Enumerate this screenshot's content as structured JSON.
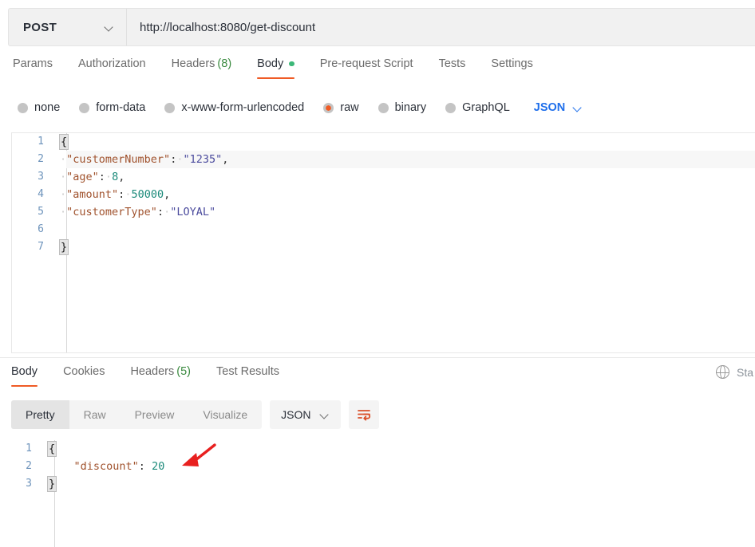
{
  "request": {
    "method": "POST",
    "url": "http://localhost:8080/get-discount",
    "method_caret_icon": "chevron-down-icon",
    "tabs": [
      {
        "label": "Params",
        "active": false,
        "count": "",
        "dot": false
      },
      {
        "label": "Authorization",
        "active": false,
        "count": "",
        "dot": false
      },
      {
        "label": "Headers",
        "active": false,
        "count": "(8)",
        "dot": false
      },
      {
        "label": "Body",
        "active": true,
        "count": "",
        "dot": true
      },
      {
        "label": "Pre-request Script",
        "active": false,
        "count": "",
        "dot": false
      },
      {
        "label": "Tests",
        "active": false,
        "count": "",
        "dot": false
      },
      {
        "label": "Settings",
        "active": false,
        "count": "",
        "dot": false
      }
    ],
    "body_types": [
      {
        "label": "none",
        "checked": false
      },
      {
        "label": "form-data",
        "checked": false
      },
      {
        "label": "x-www-form-urlencoded",
        "checked": false
      },
      {
        "label": "raw",
        "checked": true
      },
      {
        "label": "binary",
        "checked": false
      },
      {
        "label": "GraphQL",
        "checked": false
      }
    ],
    "format": "JSON",
    "format_caret_icon": "chevron-down-icon",
    "editor_lines": [
      {
        "num": "1",
        "highlight": false,
        "tokens": [
          {
            "t": "{",
            "c": "brace"
          }
        ]
      },
      {
        "num": "2",
        "highlight": true,
        "tokens": [
          {
            "t": "·",
            "c": "dot"
          },
          {
            "t": "\"customerNumber\"",
            "c": "key"
          },
          {
            "t": ":",
            "c": "punct"
          },
          {
            "t": "·",
            "c": "dot"
          },
          {
            "t": "\"1235\"",
            "c": "str"
          },
          {
            "t": ",",
            "c": "punct"
          }
        ]
      },
      {
        "num": "3",
        "highlight": false,
        "tokens": [
          {
            "t": "·",
            "c": "dot"
          },
          {
            "t": "\"age\"",
            "c": "key"
          },
          {
            "t": ":",
            "c": "punct"
          },
          {
            "t": "·",
            "c": "dot"
          },
          {
            "t": "8",
            "c": "num"
          },
          {
            "t": ",",
            "c": "punct"
          }
        ]
      },
      {
        "num": "4",
        "highlight": false,
        "tokens": [
          {
            "t": "·",
            "c": "dot"
          },
          {
            "t": "\"amount\"",
            "c": "key"
          },
          {
            "t": ":",
            "c": "punct"
          },
          {
            "t": "·",
            "c": "dot"
          },
          {
            "t": "50000",
            "c": "num"
          },
          {
            "t": ",",
            "c": "punct"
          }
        ]
      },
      {
        "num": "5",
        "highlight": false,
        "tokens": [
          {
            "t": "·",
            "c": "dot"
          },
          {
            "t": "\"customerType\"",
            "c": "key"
          },
          {
            "t": ":",
            "c": "punct"
          },
          {
            "t": "·",
            "c": "dot"
          },
          {
            "t": "\"LOYAL\"",
            "c": "str"
          }
        ]
      },
      {
        "num": "6",
        "highlight": false,
        "tokens": []
      },
      {
        "num": "7",
        "highlight": false,
        "tokens": [
          {
            "t": "}",
            "c": "brace"
          }
        ]
      }
    ]
  },
  "response": {
    "tabs": [
      {
        "label": "Body",
        "active": true,
        "count": ""
      },
      {
        "label": "Cookies",
        "active": false,
        "count": ""
      },
      {
        "label": "Headers",
        "active": false,
        "count": "(5)"
      },
      {
        "label": "Test Results",
        "active": false,
        "count": ""
      }
    ],
    "globe_icon": "globe-icon",
    "status_text": "Sta",
    "view_modes": [
      {
        "label": "Pretty",
        "active": true
      },
      {
        "label": "Raw",
        "active": false
      },
      {
        "label": "Preview",
        "active": false
      },
      {
        "label": "Visualize",
        "active": false
      }
    ],
    "format": "JSON",
    "format_caret_icon": "chevron-down-icon",
    "wrap_icon": "word-wrap-icon",
    "editor_lines": [
      {
        "num": "1",
        "highlight": false,
        "tokens": [
          {
            "t": "{",
            "c": "brace"
          }
        ]
      },
      {
        "num": "2",
        "highlight": false,
        "tokens": [
          {
            "t": "    ",
            "c": "punct"
          },
          {
            "t": "\"discount\"",
            "c": "key"
          },
          {
            "t": ": ",
            "c": "punct"
          },
          {
            "t": "20",
            "c": "num"
          }
        ]
      },
      {
        "num": "3",
        "highlight": false,
        "tokens": [
          {
            "t": "}",
            "c": "brace"
          }
        ]
      }
    ],
    "annotation": {
      "icon": "red-arrow-annotation",
      "color": "#e8201f"
    }
  },
  "colors": {
    "accent": "#ef5b25",
    "link": "#1f6feb",
    "green": "#3cb878",
    "annotation_red": "#e8201f"
  }
}
